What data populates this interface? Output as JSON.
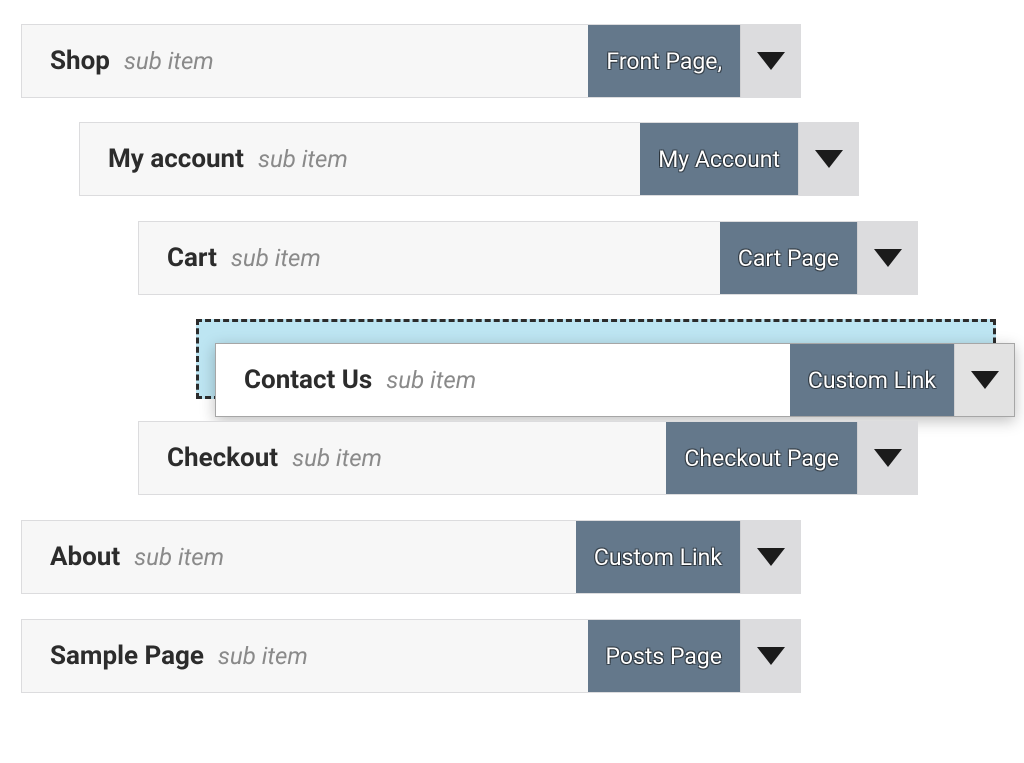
{
  "common": {
    "sub_item_label": "sub item"
  },
  "items": {
    "shop": {
      "title": "Shop",
      "type": "Front Page,"
    },
    "my_account": {
      "title": "My account",
      "type": "My Account"
    },
    "cart": {
      "title": "Cart",
      "type": "Cart Page"
    },
    "contact_us": {
      "title": "Contact Us",
      "type": "Custom Link"
    },
    "checkout": {
      "title": "Checkout",
      "type": "Checkout Page"
    },
    "about": {
      "title": "About",
      "type": "Custom Link"
    },
    "sample_page": {
      "title": "Sample Page",
      "type": "Posts Page"
    }
  }
}
